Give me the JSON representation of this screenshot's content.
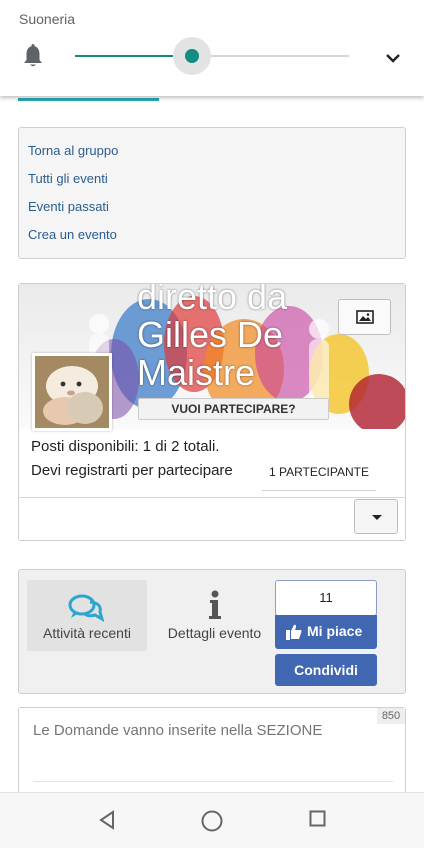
{
  "volume": {
    "title": "Suoneria",
    "level": 0.43,
    "icon": "bell-icon",
    "expand_icon": "chevron-down-icon",
    "accent_color": "#138c82"
  },
  "menu": {
    "links": [
      "Torna al gruppo",
      "Tutti gli eventi",
      "Eventi passati",
      "Crea un evento"
    ]
  },
  "event": {
    "cover_lines": [
      "diretto da",
      "Gilles De",
      "Maistre"
    ],
    "join_button": "VUOI PARTECIPARE?",
    "seats": "Posti disponibili: 1 di 2 totali.",
    "register_note": "Devi registrarti per partecipare",
    "participants": "1 PARTECIPANTE"
  },
  "actions": {
    "activity_label": "Attività recenti",
    "details_label": "Dettagli evento",
    "like_count": "11",
    "like_label": "Mi piace",
    "share_label": "Condividi",
    "brand_color": "#4267b2"
  },
  "compose": {
    "char_limit": "850",
    "placeholder": "Le Domande vanno inserite nella SEZIONE"
  }
}
